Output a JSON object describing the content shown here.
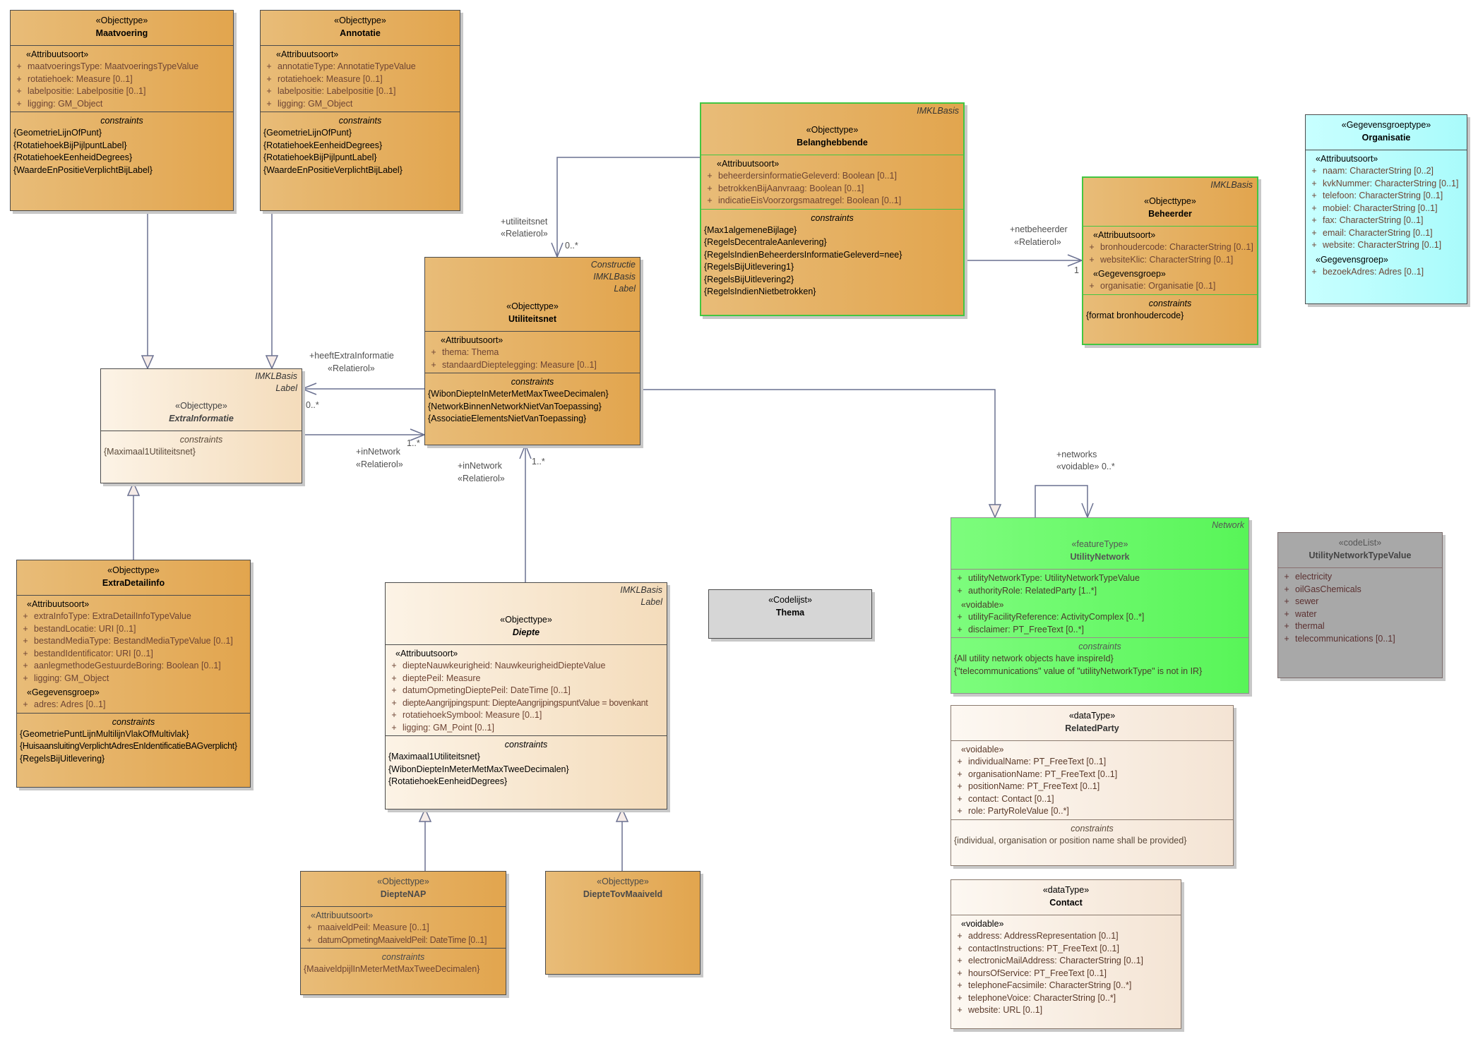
{
  "classes": {
    "maatvoering": {
      "stereotype": "«Objecttype»",
      "name": "Maatvoering",
      "attr_group": "«Attribuutsoort»",
      "attributes": [
        "maatvoeringsType: MaatvoeringsTypeValue",
        "rotatiehoek: Measure [0..1]",
        "labelpositie: Labelpositie [0..1]",
        "ligging: GM_Object"
      ],
      "constraints_title": "constraints",
      "constraints": [
        "{GeometrieLijnOfPunt}",
        "{RotatiehoekBijPijlpuntLabel}",
        "{RotatiehoekEenheidDegrees}",
        "{WaardeEnPositieVerplichtBijLabel}"
      ]
    },
    "annotatie": {
      "stereotype": "«Objecttype»",
      "name": "Annotatie",
      "attr_group": "«Attribuutsoort»",
      "attributes": [
        "annotatieType: AnnotatieTypeValue",
        "rotatiehoek: Measure [0..1]",
        "labelpositie: Labelpositie [0..1]",
        "ligging: GM_Object"
      ],
      "constraints_title": "constraints",
      "constraints": [
        "{GeometrieLijnOfPunt}",
        "{RotatiehoekEenheidDegrees}",
        "{RotatiehoekBijPijlpuntLabel}",
        "{WaardeEnPositieVerplichtBijLabel}"
      ]
    },
    "belanghebbende": {
      "tags": [
        "IMKLBasis"
      ],
      "stereotype": "«Objecttype»",
      "name": "Belanghebbende",
      "attr_group": "«Attribuutsoort»",
      "attributes": [
        "beheerdersinformatieGeleverd: Boolean [0..1]",
        "betrokkenBijAanvraag: Boolean [0..1]",
        "indicatieEisVoorzorgsmaatregel: Boolean [0..1]"
      ],
      "constraints_title": "constraints",
      "constraints": [
        "{Max1algemeneBijlage}",
        "{RegelsDecentraleAanlevering}",
        "{RegelsIndienBeheerdersInformatieGeleverd=nee}",
        "{RegelsBijUitlevering1}",
        "{RegelsBijUitlevering2}",
        "{RegelsIndienNietbetrokken}"
      ]
    },
    "beheerder": {
      "tags": [
        "IMKLBasis"
      ],
      "stereotype": "«Objecttype»",
      "name": "Beheerder",
      "attr_group": "«Attribuutsoort»",
      "attributes": [
        "bronhoudercode: CharacterString [0..1]",
        "websiteKlic: CharacterString [0..1]"
      ],
      "attr_group2": "«Gegevensgroep»",
      "attributes2": [
        "organisatie: Organisatie [0..1]"
      ],
      "constraints_title": "constraints",
      "constraints": [
        "{format bronhoudercode}"
      ]
    },
    "organisatie": {
      "stereotype": "«Gegevensgroeptype»",
      "name": "Organisatie",
      "attr_group": "«Attribuutsoort»",
      "attributes": [
        "naam: CharacterString [0..2]",
        "kvkNummer: CharacterString [0..1]",
        "telefoon: CharacterString [0..1]",
        "mobiel: CharacterString [0..1]",
        "fax: CharacterString [0..1]",
        "email: CharacterString [0..1]",
        "website: CharacterString [0..1]"
      ],
      "attr_group2": "«Gegevensgroep»",
      "attributes2": [
        "bezoekAdres: Adres [0..1]"
      ]
    },
    "utiliteitsnet": {
      "tags": [
        "Constructie",
        "IMKLBasis",
        "Label"
      ],
      "stereotype": "«Objecttype»",
      "name": "Utiliteitsnet",
      "attr_group": "«Attribuutsoort»",
      "attributes": [
        "thema: Thema",
        "standaardDieptelegging: Measure [0..1]"
      ],
      "constraints_title": "constraints",
      "constraints": [
        "{WibonDiepteInMeterMetMaxTweeDecimalen}",
        "{NetworkBinnenNetworkNietVanToepassing}",
        "{AssociatieElementsNietVanToepassing}"
      ]
    },
    "extrainformatie": {
      "tags": [
        "IMKLBasis",
        "Label"
      ],
      "stereotype": "«Objecttype»",
      "name": "ExtraInformatie",
      "constraints_title": "constraints",
      "constraints": [
        "{Maximaal1Utiliteitsnet}"
      ]
    },
    "extradetailinfo": {
      "stereotype": "«Objecttype»",
      "name": "ExtraDetailinfo",
      "attr_group": "«Attribuutsoort»",
      "attributes": [
        "extraInfoType: ExtraDetailInfoTypeValue",
        "bestandLocatie: URI [0..1]",
        "bestandMediaType: BestandMediaTypeValue [0..1]",
        "bestandIdentificator: URI [0..1]",
        "aanlegmethodeGestuurdeBoring: Boolean [0..1]",
        "ligging: GM_Object"
      ],
      "attr_group2": "«Gegevensgroep»",
      "attributes2": [
        "adres: Adres [0..1]"
      ],
      "constraints_title": "constraints",
      "constraints": [
        "{GeometriePuntLijnMultilijnVlakOfMultivlak}",
        "{HuisaansluitingVerplichtAdresEnIdentificatieBAGverplicht}",
        "{RegelsBijUitlevering}"
      ]
    },
    "diepte": {
      "tags": [
        "IMKLBasis",
        "Label"
      ],
      "stereotype": "«Objecttype»",
      "name": "Diepte",
      "attr_group": "«Attribuutsoort»",
      "attributes": [
        "diepteNauwkeurigheid: NauwkeurigheidDiepteValue",
        "dieptePeil: Measure",
        "datumOpmetingDieptePeil: DateTime [0..1]",
        "diepteAangrijpingspunt: DiepteAangrijpingspuntValue = bovenkant",
        "rotatiehoekSymbool: Measure [0..1]",
        "ligging: GM_Point [0..1]"
      ],
      "constraints_title": "constraints",
      "constraints": [
        "{Maximaal1Utiliteitsnet}",
        "{WibonDiepteInMeterMetMaxTweeDecimalen}",
        "{RotatiehoekEenheidDegrees}"
      ]
    },
    "dieptenap": {
      "stereotype": "«Objecttype»",
      "name": "DiepteNAP",
      "attr_group": "«Attribuutsoort»",
      "attributes": [
        "maaiveldPeil: Measure [0..1]",
        "datumOpmetingMaaiveldPeil: DateTime [0..1]"
      ],
      "constraints_title": "constraints",
      "constraints": [
        "{MaaiveldpijlInMeterMetMaxTweeDecimalen}"
      ]
    },
    "dieptetovmaaiveld": {
      "stereotype": "«Objecttype»",
      "name": "DiepteTovMaaiveld"
    },
    "thema": {
      "stereotype": "«Codelijst»",
      "name": "Thema"
    },
    "utilitynetwork": {
      "tags": [
        "Network"
      ],
      "stereotype": "«featureType»",
      "name": "UtilityNetwork",
      "attributes": [
        "utilityNetworkType: UtilityNetworkTypeValue",
        "authorityRole: RelatedParty [1..*]"
      ],
      "attr_group2": "«voidable»",
      "attributes2": [
        "utilityFacilityReference: ActivityComplex [0..*]",
        "disclaimer: PT_FreeText [0..*]"
      ],
      "constraints_title": "constraints",
      "constraints": [
        "{All utility network objects have inspireId}",
        "{\"telecommunications\" value of \"utilityNetworkType\" is not in IR}"
      ]
    },
    "utilitynetworktypevalue": {
      "stereotype": "«codeList»",
      "name": "UtilityNetworkTypeValue",
      "attributes": [
        "electricity",
        "oilGasChemicals",
        "sewer",
        "water",
        "thermal",
        "telecommunications [0..1]"
      ]
    },
    "relatedparty": {
      "stereotype": "«dataType»",
      "name": "RelatedParty",
      "attr_group": "«voidable»",
      "attributes": [
        "individualName: PT_FreeText [0..1]",
        "organisationName: PT_FreeText [0..1]",
        "positionName: PT_FreeText [0..1]",
        "contact: Contact [0..1]",
        "role: PartyRoleValue [0..*]"
      ],
      "constraints_title": "constraints",
      "constraints": [
        "{individual, organisation or position name shall be provided}"
      ]
    },
    "contact": {
      "stereotype": "«dataType»",
      "name": "Contact",
      "attr_group": "«voidable»",
      "attributes": [
        "address: AddressRepresentation [0..1]",
        "contactInstructions: PT_FreeText [0..1]",
        "electronicMailAddress: CharacterString [0..1]",
        "hoursOfService: PT_FreeText [0..1]",
        "telephoneFacsimile: CharacterString [0..*]",
        "telephoneVoice: CharacterString [0..*]",
        "website: URL [0..1]"
      ]
    }
  },
  "connector_labels": {
    "utiliteitsnet_role": "+utiliteitsnet",
    "utiliteitsnet_stereo": "«Relatierol»",
    "utiliteitsnet_mult": "0..*",
    "netbeheerder_role": "+netbeheerder",
    "netbeheerder_stereo": "«Relatierol»",
    "netbeheerder_mult": "1",
    "heeftextra_role": "+heeftExtraInformatie",
    "heeftextra_stereo": "«Relatierol»",
    "heeftextra_mult": "0..*",
    "innetwork1_role": "+inNetwork",
    "innetwork1_stereo": "«Relatierol»",
    "innetwork1_mult": "1..*",
    "innetwork2_role": "+inNetwork",
    "innetwork2_stereo": "«Relatierol»",
    "innetwork2_mult": "1..*",
    "networks_role": "+networks",
    "networks_stereo_mult": "«voidable» 0..*"
  }
}
